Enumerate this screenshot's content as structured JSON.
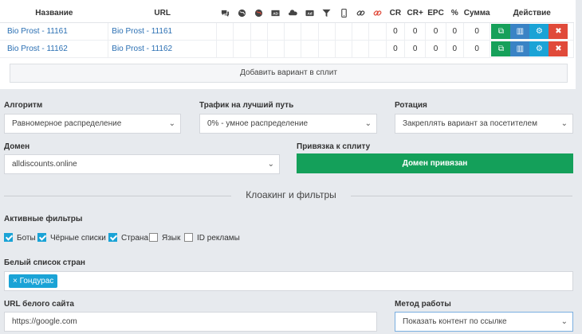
{
  "table": {
    "headers": {
      "name": "Название",
      "url": "URL",
      "cr": "CR",
      "crplus": "CR+",
      "epc": "EPC",
      "percent": "%",
      "sum": "Сумма",
      "action": "Действие"
    },
    "icon_columns": [
      "chat-icon",
      "globe-icon",
      "globe-red-icon",
      "ad-icon",
      "cloud-icon",
      "ad-alt-icon",
      "filter-icon",
      "mobile-icon",
      "link-icon",
      "link-red-icon"
    ],
    "rows": [
      {
        "name": "Bio Prost - 11161",
        "url": "Bio Prost - 11161",
        "cr": "0",
        "crplus": "0",
        "epc": "0",
        "percent": "0",
        "sum": "0"
      },
      {
        "name": "Bio Prost - 11162",
        "url": "Bio Prost - 11162",
        "cr": "0",
        "crplus": "0",
        "epc": "0",
        "percent": "0",
        "sum": "0"
      }
    ],
    "add_variant_label": "Добавить вариант в сплит"
  },
  "settings": {
    "algorithm_label": "Алгоритм",
    "algorithm_value": "Равномерное распределение",
    "traffic_label": "Трафик на лучший путь",
    "traffic_value": "0% - умное распределение",
    "rotation_label": "Ротация",
    "rotation_value": "Закреплять вариант за посетителем",
    "domain_label": "Домен",
    "domain_value": "alldiscounts.online",
    "bind_label": "Привязка к сплиту",
    "bind_button": "Домен привязан"
  },
  "cloaking": {
    "title": "Клоакинг и фильтры",
    "active_filters_label": "Активные фильтры",
    "filters": [
      {
        "label": "Боты",
        "checked": true
      },
      {
        "label": "Чёрные списки",
        "checked": true
      },
      {
        "label": "Страна",
        "checked": true
      },
      {
        "label": "Язык",
        "checked": false
      },
      {
        "label": "ID рекламы",
        "checked": false
      }
    ],
    "whitelist_label": "Белый список стран",
    "whitelist_tag": "× Гондурас",
    "white_site_label": "URL белого сайта",
    "white_site_value": "https://google.com",
    "method_label": "Метод работы",
    "method_value": "Показать контент по ссылке"
  },
  "colors": {
    "green": "#16a05a",
    "blue": "#3a83c5",
    "cyan": "#1aa3d6",
    "red": "#e04a3a",
    "link": "#2a6fb3"
  }
}
